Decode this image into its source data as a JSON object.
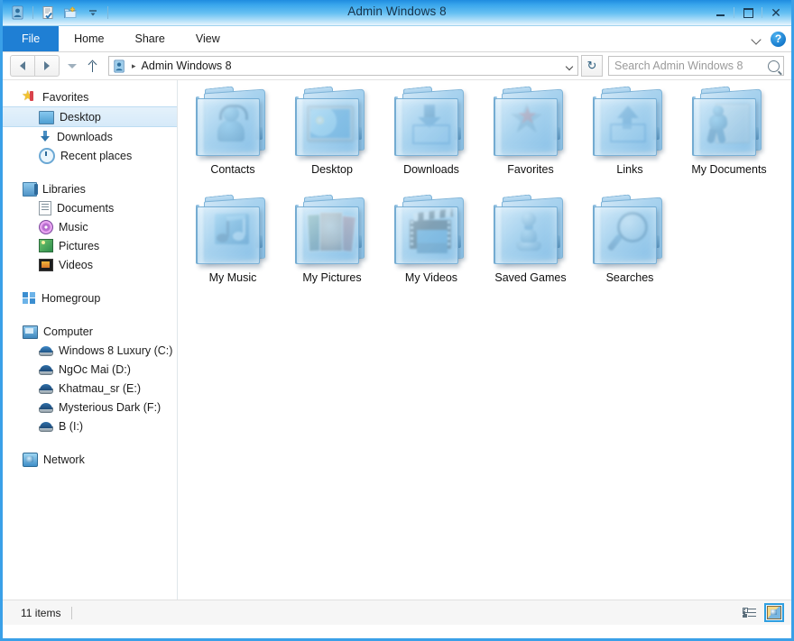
{
  "window": {
    "title": "Admin Windows 8",
    "controls": {
      "minimize": "–",
      "maximize": "▢",
      "close": "✕"
    },
    "quick_access": [
      "explorer-icon",
      "properties-icon",
      "new-folder-icon",
      "customize-dropdown"
    ]
  },
  "ribbon": {
    "tabs": [
      {
        "label": "File",
        "active": true
      },
      {
        "label": "Home",
        "active": false
      },
      {
        "label": "Share",
        "active": false
      },
      {
        "label": "View",
        "active": false
      }
    ],
    "expand_icon": "chevron-down-icon",
    "help_label": "?"
  },
  "address": {
    "back_icon": "back-arrow-icon",
    "forward_icon": "forward-arrow-icon",
    "recent_icon": "recent-locations-icon",
    "up_icon": "up-arrow-icon",
    "path_icon": "user-folder-icon",
    "separator": "▸",
    "crumb": "Admin Windows 8",
    "dropdown_icon": "chevron-down-icon",
    "refresh_icon": "↻"
  },
  "search": {
    "placeholder": "Search Admin Windows 8",
    "icon": "search-icon"
  },
  "sidebar": {
    "groups": [
      {
        "root": {
          "label": "Favorites",
          "icon": "favorites-star-icon"
        },
        "items": [
          {
            "label": "Desktop",
            "icon": "desktop-icon",
            "selected": true
          },
          {
            "label": "Downloads",
            "icon": "downloads-icon",
            "selected": false
          },
          {
            "label": "Recent places",
            "icon": "recent-places-icon",
            "selected": false
          }
        ]
      },
      {
        "root": {
          "label": "Libraries",
          "icon": "libraries-icon"
        },
        "items": [
          {
            "label": "Documents",
            "icon": "documents-icon",
            "selected": false
          },
          {
            "label": "Music",
            "icon": "music-icon",
            "selected": false
          },
          {
            "label": "Pictures",
            "icon": "pictures-icon",
            "selected": false
          },
          {
            "label": "Videos",
            "icon": "videos-icon",
            "selected": false
          }
        ]
      },
      {
        "root": {
          "label": "Homegroup",
          "icon": "homegroup-icon"
        },
        "items": []
      },
      {
        "root": {
          "label": "Computer",
          "icon": "computer-icon"
        },
        "items": [
          {
            "label": "Windows 8 Luxury (C:)",
            "icon": "system-drive-icon",
            "selected": false
          },
          {
            "label": "NgOc Mai (D:)",
            "icon": "drive-icon",
            "selected": false
          },
          {
            "label": "Khatmau_sr (E:)",
            "icon": "drive-icon",
            "selected": false
          },
          {
            "label": "Mysterious Dark (F:)",
            "icon": "drive-icon",
            "selected": false
          },
          {
            "label": "B (I:)",
            "icon": "drive-icon",
            "selected": false
          }
        ]
      },
      {
        "root": {
          "label": "Network",
          "icon": "network-icon"
        },
        "items": []
      }
    ]
  },
  "files": [
    {
      "name": "Contacts",
      "icon": "folder-contacts-icon"
    },
    {
      "name": "Desktop",
      "icon": "folder-desktop-icon"
    },
    {
      "name": "Downloads",
      "icon": "folder-downloads-icon"
    },
    {
      "name": "Favorites",
      "icon": "folder-favorites-icon"
    },
    {
      "name": "Links",
      "icon": "folder-links-icon"
    },
    {
      "name": "My Documents",
      "icon": "folder-documents-icon"
    },
    {
      "name": "My Music",
      "icon": "folder-music-icon"
    },
    {
      "name": "My Pictures",
      "icon": "folder-pictures-icon"
    },
    {
      "name": "My Videos",
      "icon": "folder-videos-icon"
    },
    {
      "name": "Saved Games",
      "icon": "folder-savedgames-icon"
    },
    {
      "name": "Searches",
      "icon": "folder-searches-icon"
    }
  ],
  "status": {
    "item_count": "11 items",
    "views": [
      {
        "name": "details-view",
        "active": false
      },
      {
        "name": "large-icons-view",
        "active": true
      }
    ]
  },
  "colors": {
    "accent": "#1f7fd4",
    "titlebar_blue": "#3aa7ec",
    "frame_border": "#3aa0e8",
    "selection": "#d6eaf9"
  }
}
